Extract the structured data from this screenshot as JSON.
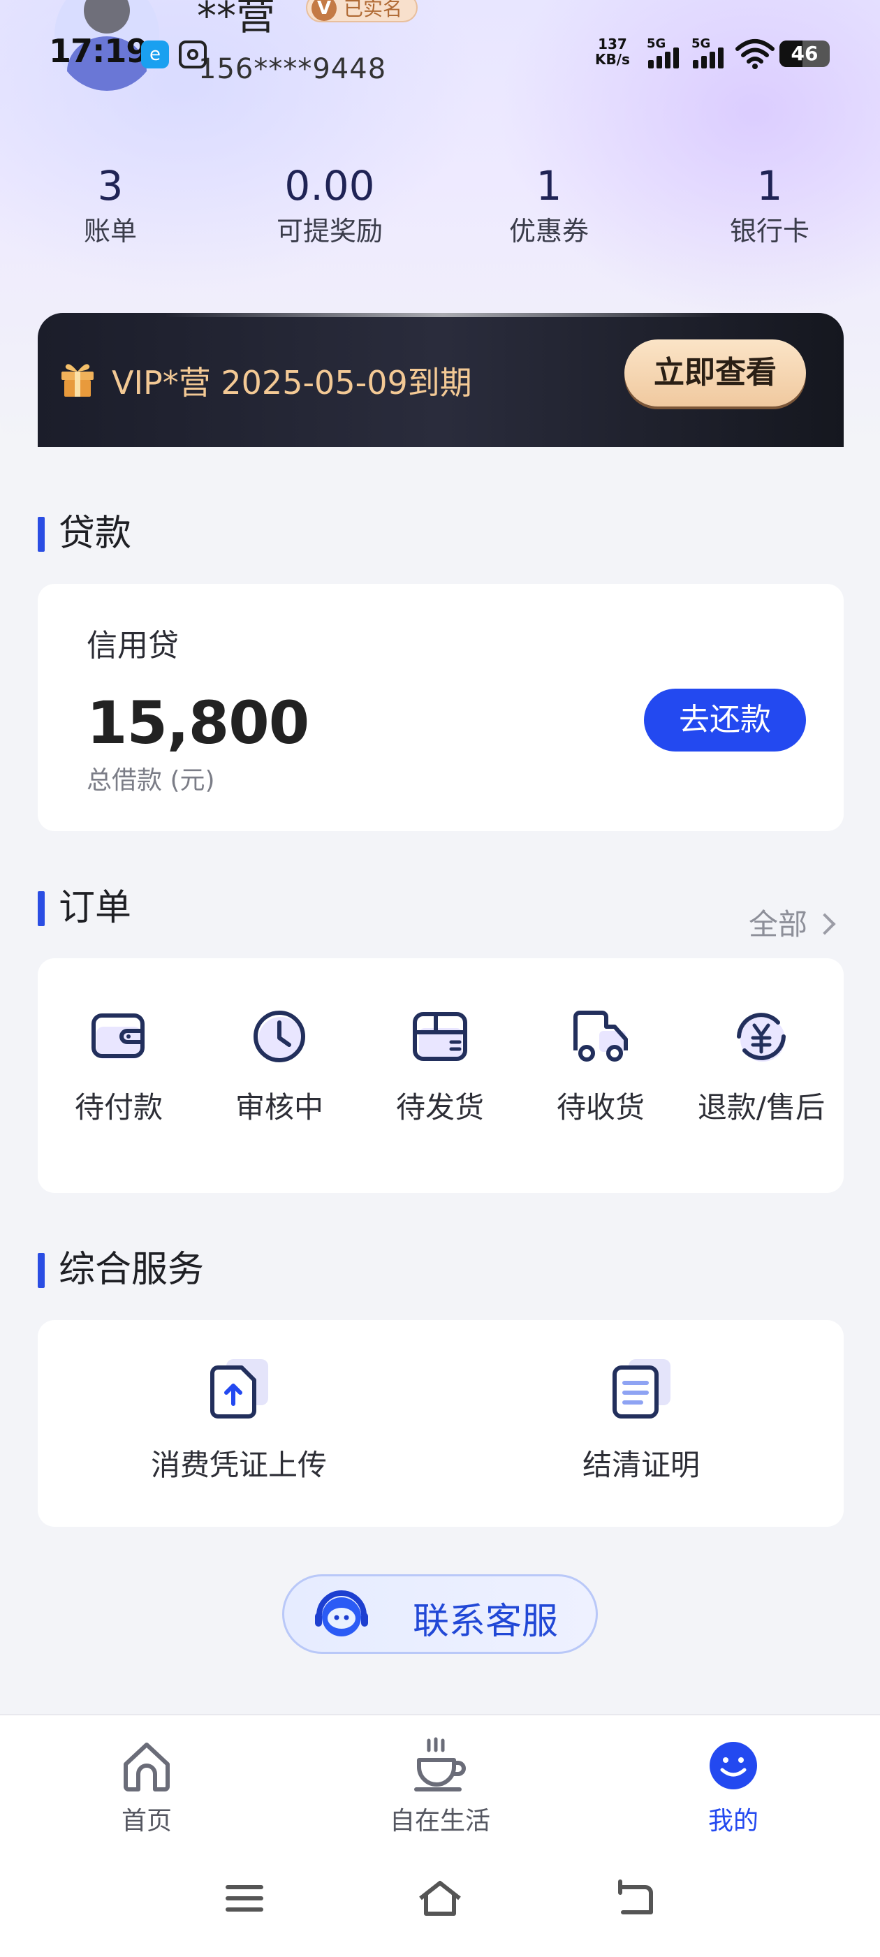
{
  "status_bar": {
    "time": "17:19",
    "app_icon_1": "e",
    "net_speed_value": "137",
    "net_speed_unit": "KB/s",
    "signal_1": "5G",
    "signal_2": "5G",
    "battery": "46",
    "battery_level": 0.46
  },
  "user": {
    "name": "**营",
    "badge_icon": "V",
    "badge": "已实名",
    "phone": "156****9448"
  },
  "stats": [
    {
      "value": "3",
      "label": "账单"
    },
    {
      "value": "0.00",
      "label": "可提奖励"
    },
    {
      "value": "1",
      "label": "优惠券"
    },
    {
      "value": "1",
      "label": "银行卡"
    }
  ],
  "vip": {
    "text": "VIP*营 2025-05-09到期",
    "button": "立即查看",
    "colors": {
      "text": "#f3c995",
      "button": "#f5d7b4"
    }
  },
  "loan": {
    "section_title": "贷款",
    "product": "信用贷",
    "amount": "15,800",
    "amount_label": "总借款 (元)",
    "repay_button": "去还款"
  },
  "orders": {
    "section_title": "订单",
    "all_link": "全部",
    "items": [
      {
        "label": "待付款",
        "icon": "wallet-icon"
      },
      {
        "label": "审核中",
        "icon": "clock-icon"
      },
      {
        "label": "待发货",
        "icon": "package-icon"
      },
      {
        "label": "待收货",
        "icon": "truck-icon"
      },
      {
        "label": "退款/售后",
        "icon": "refund-icon"
      }
    ]
  },
  "services": {
    "section_title": "综合服务",
    "items": [
      {
        "label": "消费凭证上传",
        "icon": "upload-document-icon"
      },
      {
        "label": "结清证明",
        "icon": "certificate-document-icon"
      }
    ]
  },
  "customer_service": {
    "label": "联系客服"
  },
  "tabbar": {
    "items": [
      {
        "label": "首页",
        "icon": "home-icon"
      },
      {
        "label": "自在生活",
        "icon": "coffee-cup-icon"
      },
      {
        "label": "我的",
        "icon": "smiley-icon",
        "active": true
      }
    ],
    "active_color": "#2349f0"
  },
  "accent_color": "#2349f0"
}
